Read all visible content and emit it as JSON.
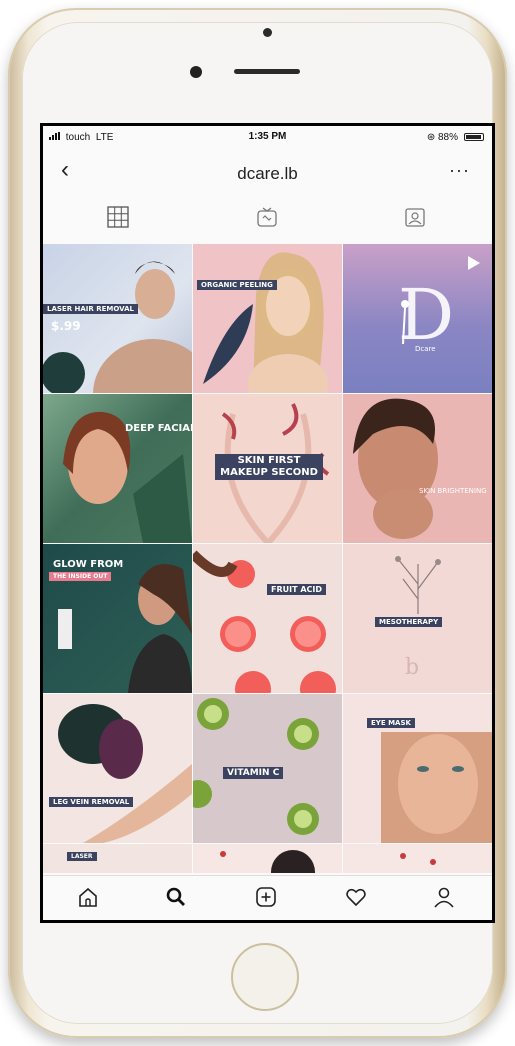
{
  "status_bar": {
    "carrier": "touch",
    "network": "LTE",
    "time": "1:35 PM",
    "battery": "88%"
  },
  "header": {
    "title": "dcare.lb"
  },
  "tabs": [
    {
      "name": "grid-icon",
      "active": true
    },
    {
      "name": "igtv-icon",
      "active": false
    },
    {
      "name": "tagged-icon",
      "active": false
    }
  ],
  "posts": [
    {
      "caption": "LASER HAIR REMOVAL",
      "price": "$.99"
    },
    {
      "caption": "ORGANIC PEELING"
    },
    {
      "caption": "Dcare",
      "type": "video"
    },
    {
      "caption": "DEEP FACIAL"
    },
    {
      "caption": "SKIN FIRST MAKEUP SECOND"
    },
    {
      "caption": "SKIN BRIGHTENING"
    },
    {
      "caption": "GLOW FROM",
      "subcaption": "THE INSIDE OUT"
    },
    {
      "caption": "FRUIT ACID"
    },
    {
      "caption": "MESOTHERAPY"
    },
    {
      "caption": "LEG VEIN REMOVAL"
    },
    {
      "caption": "VITAMIN C"
    },
    {
      "caption": "EYE MASK"
    },
    {
      "caption": "LASER"
    }
  ],
  "bottom_nav": [
    "home-icon",
    "search-icon",
    "add-post-icon",
    "heart-icon",
    "profile-icon"
  ],
  "colors": {
    "accent_band": "#3b4360",
    "phone_gold": "#d9cbae"
  }
}
